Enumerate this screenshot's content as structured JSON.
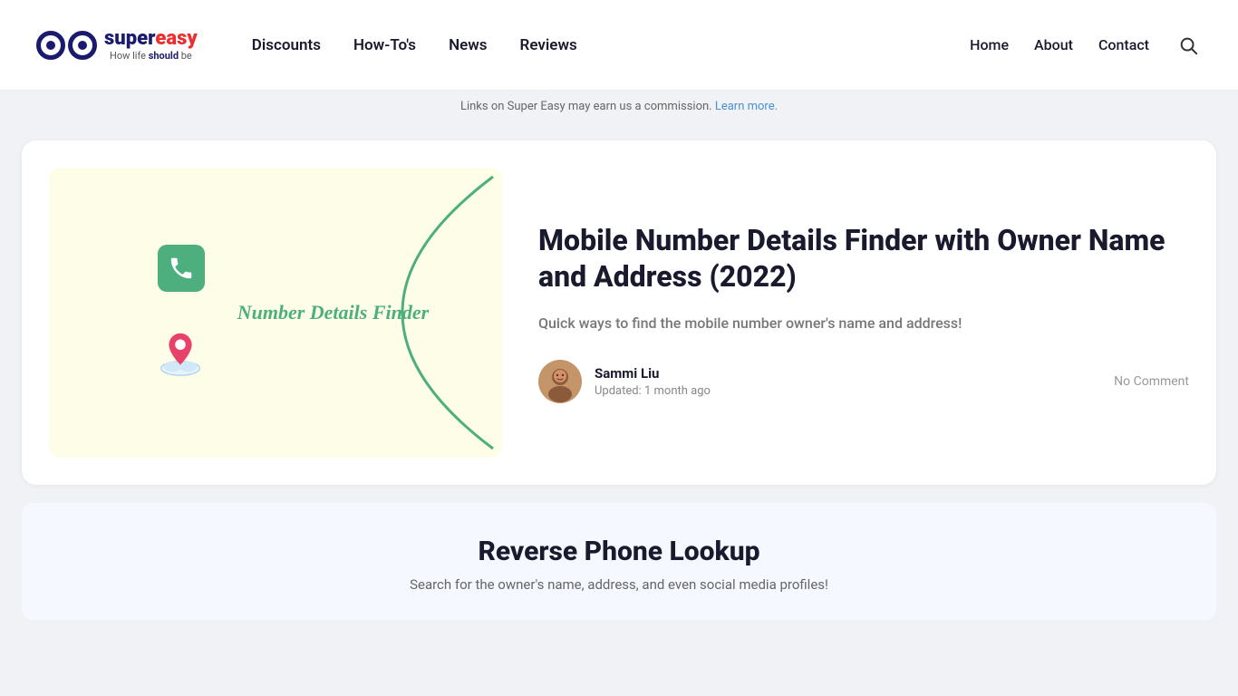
{
  "header": {
    "logo": {
      "brand_super": "super",
      "brand_easy": "easy",
      "tagline_pre": "How life ",
      "tagline_bold": "should",
      "tagline_post": " be"
    },
    "nav": {
      "items": [
        {
          "label": "Discounts",
          "id": "discounts"
        },
        {
          "label": "How-To's",
          "id": "howtos"
        },
        {
          "label": "News",
          "id": "news"
        },
        {
          "label": "Reviews",
          "id": "reviews"
        }
      ]
    },
    "secondary_nav": {
      "items": [
        {
          "label": "Home",
          "id": "home"
        },
        {
          "label": "About",
          "id": "about"
        },
        {
          "label": "Contact",
          "id": "contact"
        }
      ]
    },
    "search_label": "Search"
  },
  "affiliate_bar": {
    "text": "Links on Super Easy may earn us a commission. Learn more."
  },
  "article": {
    "title": "Mobile Number Details Finder with Owner Name and Address (2022)",
    "subtitle": "Quick ways to find the mobile number owner's name and address!",
    "image_alt": "Number Details Finder illustration",
    "finder_text": "Number Details Finder",
    "author": {
      "name": "Sammi Liu",
      "updated": "Updated: 1 month ago"
    },
    "comment_label": "No Comment"
  },
  "lookup": {
    "title": "Reverse Phone Lookup",
    "subtitle": "Search for the owner's name, address, and even social media profiles!"
  }
}
